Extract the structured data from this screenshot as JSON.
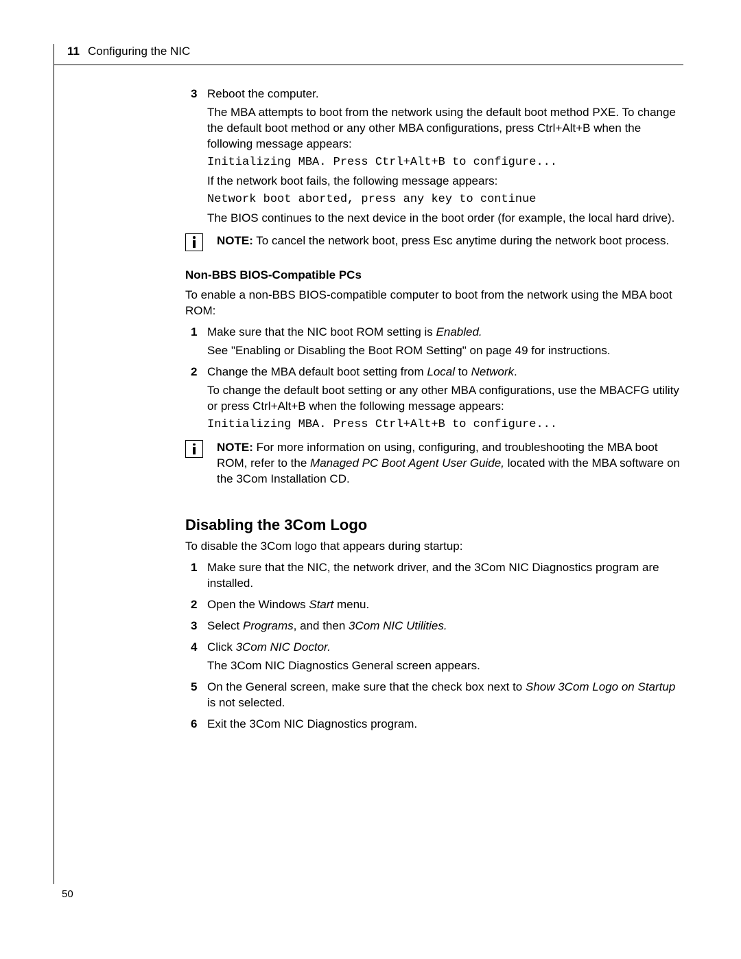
{
  "header": {
    "chapter_number": "11",
    "chapter_title": "Configuring the NIC"
  },
  "section_a": {
    "step3_num": "3",
    "step3_text": "Reboot the computer.",
    "step3_p1": "The MBA attempts to boot from the network using the default boot method PXE. To change the default boot method or any other MBA configurations, press Ctrl+Alt+B when the following message appears:",
    "step3_code1": "Initializing MBA. Press Ctrl+Alt+B to configure...",
    "step3_p2": "If the network boot fails, the following message appears:",
    "step3_code2": "Network boot aborted, press any key to continue",
    "step3_p3": "The BIOS continues to the next device in the boot order (for example, the local hard drive)."
  },
  "note1_label": "NOTE:",
  "note1_text": " To cancel the network boot, press Esc anytime during the network boot process.",
  "section_b": {
    "heading": "Non-BBS BIOS-Compatible PCs",
    "intro": "To enable a non-BBS BIOS-compatible computer to boot from the network using the MBA boot ROM:",
    "step1_num": "1",
    "step1_pre": "Make sure that the NIC boot ROM setting is ",
    "step1_em": "Enabled.",
    "step1_sub": "See \"Enabling or Disabling the Boot ROM Setting\" on page 49 for instructions.",
    "step2_num": "2",
    "step2_pre": "Change the MBA default boot setting from ",
    "step2_em1": "Local",
    "step2_mid": " to ",
    "step2_em2": "Network",
    "step2_post": ".",
    "step2_sub": "To change the default boot setting or any other MBA configurations, use the MBACFG utility or press Ctrl+Alt+B when the following message appears:",
    "step2_code": "Initializing MBA. Press Ctrl+Alt+B to configure..."
  },
  "note2_label": "NOTE:",
  "note2_pre": " For more information on using, configuring, and troubleshooting the MBA boot ROM, refer to the ",
  "note2_em": "Managed PC Boot Agent User Guide,",
  "note2_post": " located with the MBA software on the 3Com Installation CD.",
  "section_c": {
    "heading": "Disabling the 3Com Logo",
    "intro": "To disable the 3Com logo that appears during startup:",
    "step1_num": "1",
    "step1_text": "Make sure that the NIC, the network driver, and the 3Com NIC Diagnostics program are installed.",
    "step2_num": "2",
    "step2_pre": "Open the Windows ",
    "step2_em": "Start",
    "step2_post": " menu.",
    "step3_num": "3",
    "step3_pre": "Select ",
    "step3_em1": "Programs",
    "step3_mid": ", and then ",
    "step3_em2": "3Com NIC Utilities.",
    "step4_num": "4",
    "step4_pre": "Click ",
    "step4_em": "3Com NIC Doctor.",
    "step4_sub": "The 3Com NIC Diagnostics General screen appears.",
    "step5_num": "5",
    "step5_pre": "On the General screen, make sure that the check box next to ",
    "step5_em": "Show 3Com Logo on Startup",
    "step5_post": " is not selected.",
    "step6_num": "6",
    "step6_text": "Exit the 3Com NIC Diagnostics program."
  },
  "page_number": "50"
}
